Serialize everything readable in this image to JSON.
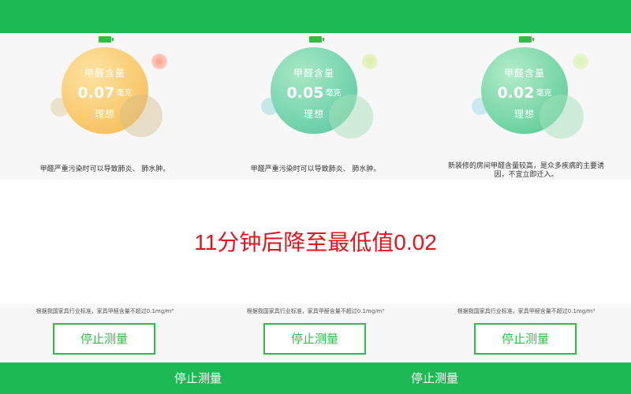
{
  "panels": [
    {
      "label": "甲醛含量",
      "value": "0.07",
      "unit": "毫克",
      "status": "理想",
      "description": "甲醛严重污染时可以导致肺炎、 肺水肿。"
    },
    {
      "label": "甲醛含量",
      "value": "0.05",
      "unit": "毫克",
      "status": "理想",
      "description": "甲醛严重污染时可以导致肺炎、 肺水肿。"
    },
    {
      "label": "甲醛含量",
      "value": "0.02",
      "unit": "毫克",
      "status": "理想",
      "description": "新装修的房间甲醛含量较高，是众多疾病的主要诱因，不宜立即迁入。"
    }
  ],
  "headline": "11分钟后降至最低值0.02",
  "standard_note": "根据我国家具行业标准，家具甲醛含量不超过0.1mg/m³",
  "stop_button_label": "停止测量",
  "bottom_bar": {
    "label_left": "停止测量",
    "label_right": "停止测量"
  },
  "icons": {
    "battery": "battery-full-icon"
  },
  "colors": {
    "brand_green": "#1db954",
    "button_green": "#2ebd45",
    "headline_red": "#e3141c",
    "circle_orange": "#f7c25a",
    "circle_teal": "#5ccf9f",
    "circle_green": "#52c990"
  }
}
